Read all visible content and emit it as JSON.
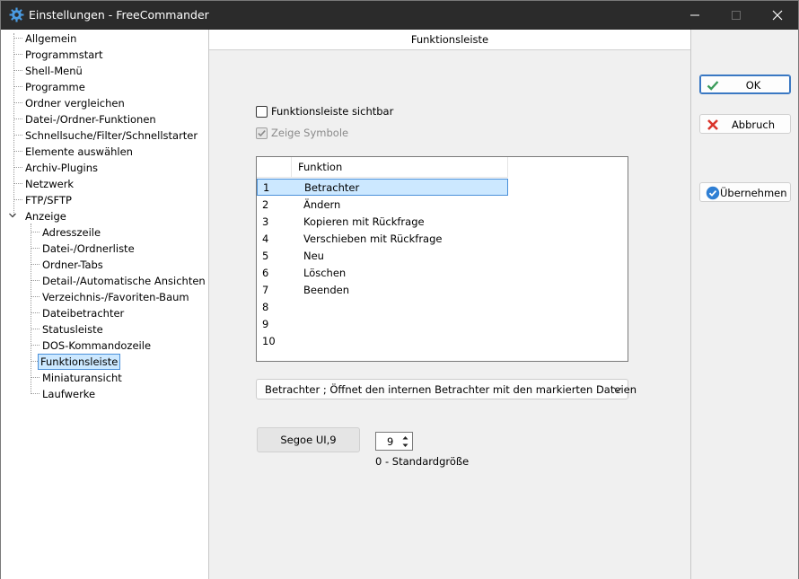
{
  "window": {
    "title": "Einstellungen - FreeCommander"
  },
  "tree": {
    "items": [
      {
        "label": "Allgemein"
      },
      {
        "label": "Programmstart"
      },
      {
        "label": "Shell-Menü"
      },
      {
        "label": "Programme"
      },
      {
        "label": "Ordner vergleichen"
      },
      {
        "label": "Datei-/Ordner-Funktionen"
      },
      {
        "label": "Schnellsuche/Filter/Schnellstarter"
      },
      {
        "label": "Elemente auswählen"
      },
      {
        "label": "Archiv-Plugins"
      },
      {
        "label": "Netzwerk"
      },
      {
        "label": "FTP/SFTP"
      },
      {
        "label": "Anzeige"
      }
    ],
    "children": [
      {
        "label": "Adresszeile"
      },
      {
        "label": "Datei-/Ordnerliste"
      },
      {
        "label": "Ordner-Tabs"
      },
      {
        "label": "Detail-/Automatische Ansichten"
      },
      {
        "label": "Verzeichnis-/Favoriten-Baum"
      },
      {
        "label": "Dateibetrachter"
      },
      {
        "label": "Statusleiste"
      },
      {
        "label": "DOS-Kommandozeile"
      },
      {
        "label": "Funktionsleiste"
      },
      {
        "label": "Miniaturansicht"
      },
      {
        "label": "Laufwerke"
      }
    ],
    "selected": "Funktionsleiste"
  },
  "panel": {
    "header": "Funktionsleiste",
    "chk_visible": {
      "label": "Funktionsleiste sichtbar",
      "checked": false
    },
    "chk_symbols": {
      "label": "Zeige Symbole",
      "checked": true,
      "disabled": true
    },
    "list": {
      "column": "Funktion",
      "rows": [
        {
          "num": "1",
          "fn": "Betrachter"
        },
        {
          "num": "2",
          "fn": "Ändern"
        },
        {
          "num": "3",
          "fn": "Kopieren mit Rückfrage"
        },
        {
          "num": "4",
          "fn": "Verschieben mit Rückfrage"
        },
        {
          "num": "5",
          "fn": "Neu"
        },
        {
          "num": "6",
          "fn": "Löschen"
        },
        {
          "num": "7",
          "fn": "Beenden"
        },
        {
          "num": "8",
          "fn": ""
        },
        {
          "num": "9",
          "fn": ""
        },
        {
          "num": "10",
          "fn": ""
        }
      ],
      "selected_row": 0
    },
    "combo_value": "Betrachter ; Öffnet den internen Betrachter mit den markierten Dateien",
    "font_button": "Segoe UI,9",
    "size_value": "9",
    "size_hint": "0 - Standardgröße"
  },
  "buttons": {
    "ok": "OK",
    "cancel": "Abbruch",
    "apply": "Übernehmen"
  },
  "colors": {
    "titlebar": "#2b2b2b",
    "selection": "#cce8ff",
    "selection_border": "#4a90d9",
    "ok_icon": "#3a9b5a",
    "cancel_icon": "#d9342b",
    "apply_icon": "#2f7fd4"
  },
  "icons": {
    "title": "gear-icon",
    "minimize": "minimize-icon",
    "maximize": "maximize-icon",
    "close": "close-icon",
    "ok": "check-icon",
    "cancel": "x-icon",
    "apply": "check-circle-icon"
  }
}
